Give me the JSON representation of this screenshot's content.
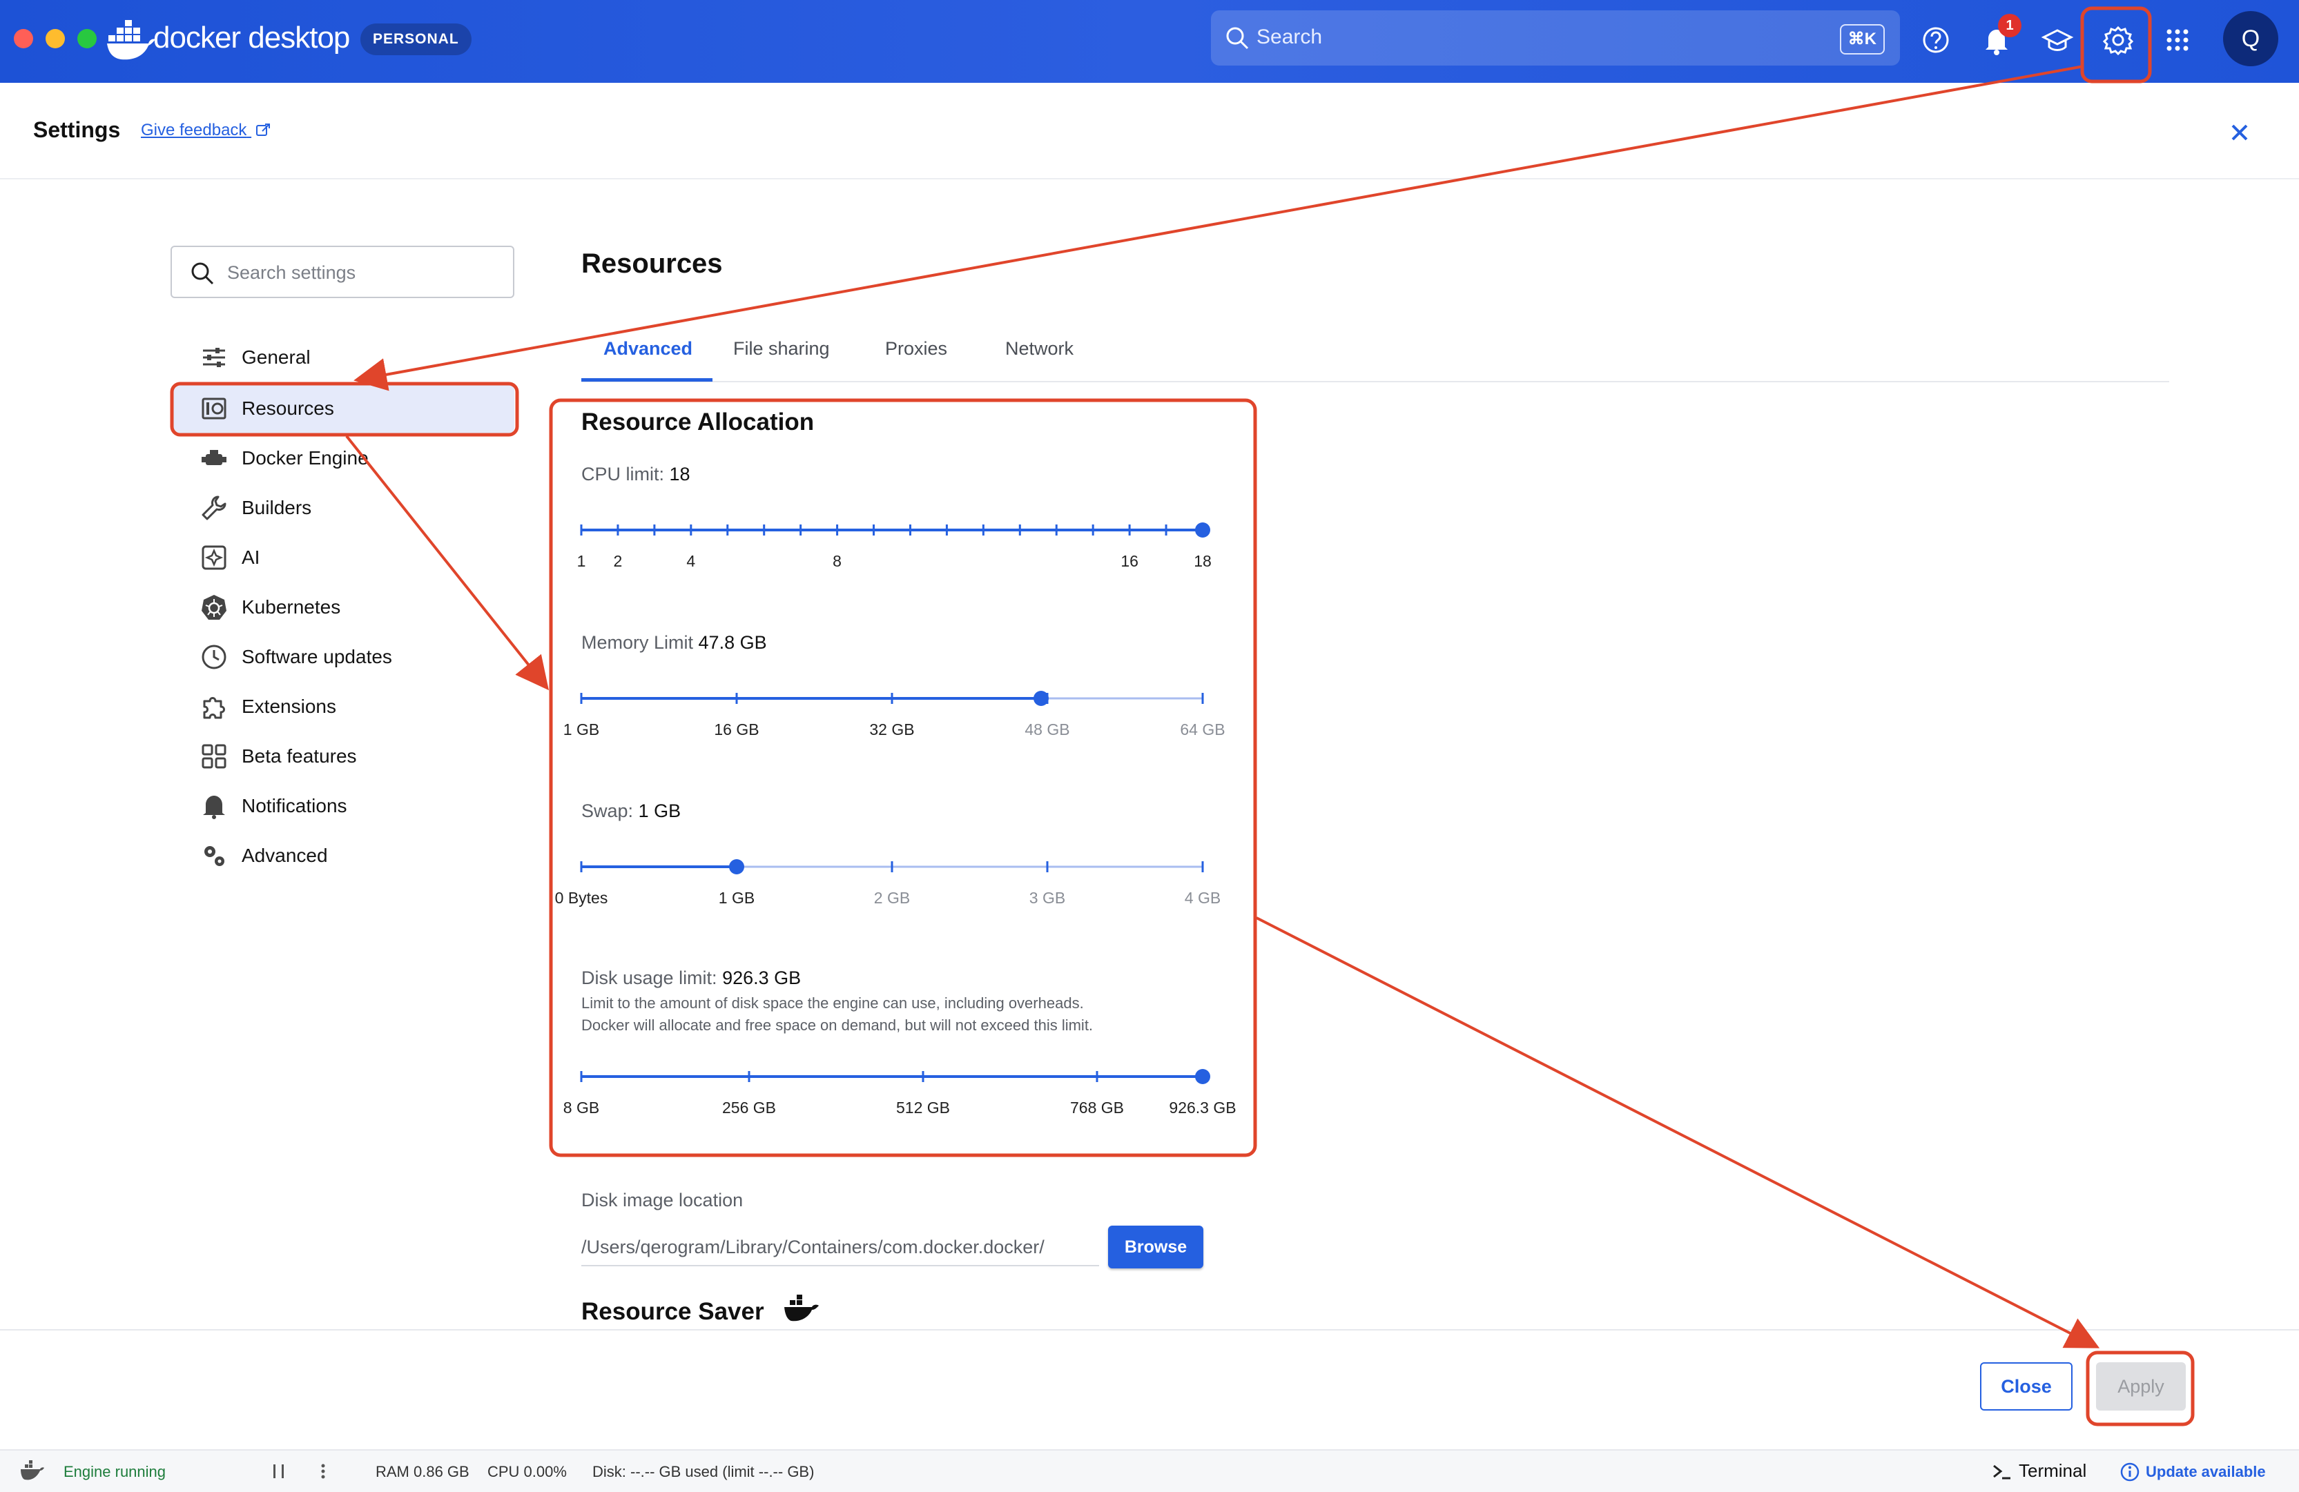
{
  "app": {
    "brand": "docker desktop",
    "plan_badge": "PERSONAL",
    "search_placeholder": "Search",
    "search_shortcut": "⌘K",
    "notification_count": "1",
    "avatar_initial": "Q"
  },
  "header": {
    "title": "Settings",
    "feedback_link": "Give feedback"
  },
  "sidebar": {
    "search_placeholder": "Search settings",
    "items": [
      {
        "label": "General",
        "icon": "sliders-icon"
      },
      {
        "label": "Resources",
        "icon": "resources-icon",
        "active": true
      },
      {
        "label": "Docker Engine",
        "icon": "engine-icon"
      },
      {
        "label": "Builders",
        "icon": "wrench-icon"
      },
      {
        "label": "AI",
        "icon": "ai-icon"
      },
      {
        "label": "Kubernetes",
        "icon": "kubernetes-icon"
      },
      {
        "label": "Software updates",
        "icon": "clock-icon"
      },
      {
        "label": "Extensions",
        "icon": "puzzle-icon"
      },
      {
        "label": "Beta features",
        "icon": "grid-icon"
      },
      {
        "label": "Notifications",
        "icon": "bell-icon"
      },
      {
        "label": "Advanced",
        "icon": "gears-icon"
      }
    ]
  },
  "main": {
    "page_title": "Resources",
    "tabs": [
      "Advanced",
      "File sharing",
      "Proxies",
      "Network"
    ],
    "active_tab": "Advanced",
    "section_title": "Resource Allocation",
    "cpu": {
      "label": "CPU limit:",
      "value": "18",
      "min": 1,
      "max": 18,
      "current": 18,
      "ticks": [
        "1",
        "2",
        "4",
        "8",
        "16",
        "18"
      ]
    },
    "memory": {
      "label": "Memory Limit",
      "value": "47.8 GB",
      "current_fraction": 0.74,
      "ticks": [
        "1 GB",
        "16 GB",
        "32 GB",
        "48 GB",
        "64 GB"
      ]
    },
    "swap": {
      "label": "Swap:",
      "value": "1 GB",
      "current_fraction": 0.25,
      "ticks": [
        "0 Bytes",
        "1 GB",
        "2 GB",
        "3 GB",
        "4 GB"
      ]
    },
    "disk": {
      "label": "Disk usage limit:",
      "value": "926.3 GB",
      "description_1": "Limit to the amount of disk space the engine can use, including overheads.",
      "description_2": "Docker will allocate and free space on demand, but will not exceed this limit.",
      "current_fraction": 1.0,
      "ticks": [
        "8 GB",
        "256 GB",
        "512 GB",
        "768 GB",
        "926.3 GB"
      ]
    },
    "disk_image": {
      "label": "Disk image location",
      "path": "/Users/qerogram/Library/Containers/com.docker.docker/",
      "browse_label": "Browse"
    },
    "resource_saver_title": "Resource Saver"
  },
  "footer": {
    "close_label": "Close",
    "apply_label": "Apply"
  },
  "statusbar": {
    "engine": "Engine running",
    "ram": "RAM 0.86 GB",
    "cpu": "CPU 0.00%",
    "disk": "Disk: --.-- GB used (limit --.-- GB)",
    "terminal": "Terminal",
    "update": "Update available"
  },
  "colors": {
    "accent": "#2560e0",
    "titlebar": "#1f56d9",
    "annotation": "#e0452b"
  }
}
